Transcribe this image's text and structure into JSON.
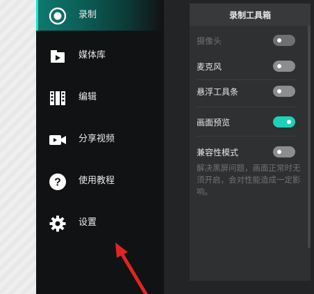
{
  "sidebar": {
    "items": [
      {
        "label": "录制",
        "icon": "record-icon",
        "active": true
      },
      {
        "label": "媒体库",
        "icon": "media-library-icon",
        "active": false
      },
      {
        "label": "编辑",
        "icon": "film-edit-icon",
        "active": false
      },
      {
        "label": "分享视频",
        "icon": "video-camera-icon",
        "active": false
      },
      {
        "label": "使用教程",
        "icon": "question-icon",
        "active": false
      },
      {
        "label": "设置",
        "icon": "gear-icon",
        "active": false
      }
    ]
  },
  "panel": {
    "title": "录制工具箱",
    "options": [
      {
        "label": "摄像头",
        "enabled": false,
        "disabled": true
      },
      {
        "label": "麦克风",
        "enabled": false,
        "disabled": false
      },
      {
        "label": "悬浮工具条",
        "enabled": false,
        "disabled": false
      },
      {
        "label": "画面预览",
        "enabled": true,
        "disabled": false
      },
      {
        "label": "兼容性模式",
        "enabled": false,
        "disabled": false
      }
    ],
    "compat_description": "解决黑屏问题，画面正常时无须开启，会对性能造成一定影响。"
  },
  "colors": {
    "accent": "#1ed0b8",
    "sidebar_bg": "#111213",
    "panel_bg": "#2e3031",
    "arrow": "#e02424"
  }
}
